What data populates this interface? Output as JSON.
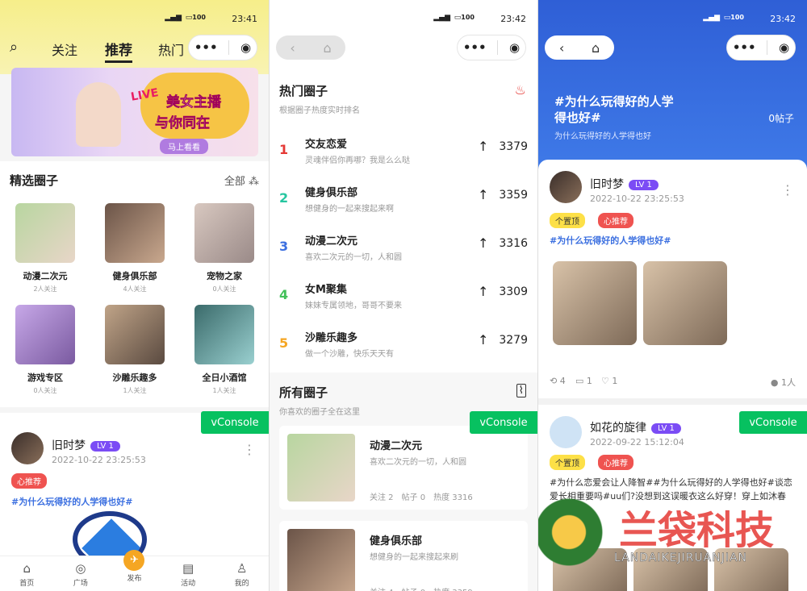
{
  "s1": {
    "status_time": "23:41",
    "status_battery": "100",
    "nav": {
      "follow": "关注",
      "recommend": "推荐",
      "hot": "热门"
    },
    "banner": {
      "title": "美女主播",
      "sub": "与你同在",
      "btn": "马上看看",
      "logo": "LIVE"
    },
    "section_title": "精选圈子",
    "all_label": "全部",
    "circles": [
      {
        "name": "动漫二次元",
        "followers": "2人关注",
        "colors": [
          "#b8d6a0",
          "#e8d6c8"
        ]
      },
      {
        "name": "健身俱乐部",
        "followers": "4人关注",
        "colors": [
          "#6b5448",
          "#c9a88e"
        ]
      },
      {
        "name": "宠物之家",
        "followers": "0人关注",
        "colors": [
          "#d8c8c0",
          "#9a8a88"
        ]
      },
      {
        "name": "游戏专区",
        "followers": "0人关注",
        "colors": [
          "#c7a8e8",
          "#7a5aa0"
        ]
      },
      {
        "name": "沙雕乐趣多",
        "followers": "1人关注",
        "colors": [
          "#c0a488",
          "#5a4a40"
        ]
      },
      {
        "name": "全日小酒馆",
        "followers": "1人关注",
        "colors": [
          "#3a6a6a",
          "#9ad0d0"
        ]
      }
    ],
    "post": {
      "user": "旧时梦",
      "level": "LV 1",
      "time": "2022-10-22 23:25:53",
      "tag": "心推荐",
      "hashtag": "#为什么玩得好的人学得也好#"
    },
    "vconsole": "vConsole",
    "tabs": [
      {
        "label": "首页",
        "icon": "home-icon"
      },
      {
        "label": "广场",
        "icon": "compass-icon"
      },
      {
        "label": "发布",
        "icon": "rocket-icon"
      },
      {
        "label": "活动",
        "icon": "activity-icon"
      },
      {
        "label": "我的",
        "icon": "user-icon"
      }
    ]
  },
  "s2": {
    "status_time": "23:42",
    "status_battery": "100",
    "hot_title": "热门圈子",
    "hot_sub": "根据圈子热度实时排名",
    "ranks": [
      {
        "no": "1",
        "name": "交友恋爱",
        "desc": "灵魂伴侣你再哪？我是么么哒",
        "score": "3379",
        "color": "#e53935"
      },
      {
        "no": "2",
        "name": "健身俱乐部",
        "desc": "想健身的一起来搜起来啊",
        "score": "3359",
        "color": "#26c6a0"
      },
      {
        "no": "3",
        "name": "动漫二次元",
        "desc": "喜欢二次元的一切，人和圆",
        "score": "3316",
        "color": "#3b6fe0"
      },
      {
        "no": "4",
        "name": "女M聚集",
        "desc": "妹妹专属领地，哥哥不要来",
        "score": "3309",
        "color": "#43c05a"
      },
      {
        "no": "5",
        "name": "沙雕乐趣多",
        "desc": "做一个沙雕，快乐天天有",
        "score": "3279",
        "color": "#f5a623"
      }
    ],
    "all_title": "所有圈子",
    "all_sub": "你喜欢的圈子全在这里",
    "cards": [
      {
        "name": "动漫二次元",
        "desc": "喜欢二次元的一切，人和圆",
        "stats": "关注 2　帖子 0　热度 3316",
        "colors": [
          "#b8d6a0",
          "#e8d6c8"
        ]
      },
      {
        "name": "健身俱乐部",
        "desc": "想健身的一起来搜起来刷",
        "stats": "关注 4　帖子 0　热度 3359",
        "colors": [
          "#6b5448",
          "#c9a88e"
        ]
      }
    ],
    "vconsole": "vConsole"
  },
  "s3": {
    "status_time": "23:42",
    "status_battery": "100",
    "topic": "#为什么玩得好的人学得也好#",
    "topic_sub": "为什么玩得好的人学得也好",
    "count": "0帖子",
    "post1": {
      "user": "旧时梦",
      "level": "LV 1",
      "time": "2022-10-22 23:25:53",
      "tags": [
        "个置顶",
        "心推荐"
      ],
      "hashtag": "#为什么玩得好的人学得也好#",
      "shares": "4",
      "comments": "1",
      "likes": "1",
      "people": "1人"
    },
    "post2": {
      "user": "如花的旋律",
      "level": "LV 1",
      "time": "2022-09-22 15:12:04",
      "tags": [
        "个置顶",
        "心推荐"
      ],
      "text": "#为什么恋爱会让人降智##为什么玩得好的人学得也好#谈恋爱长相重要吗#uu们?没想到这误暖衣这么好穿！穿上如沐春风！…"
    },
    "vconsole": "vConsole",
    "watermark": {
      "cn": "兰袋科技",
      "en": "LANDAIKEJIRUANJIAN"
    }
  }
}
